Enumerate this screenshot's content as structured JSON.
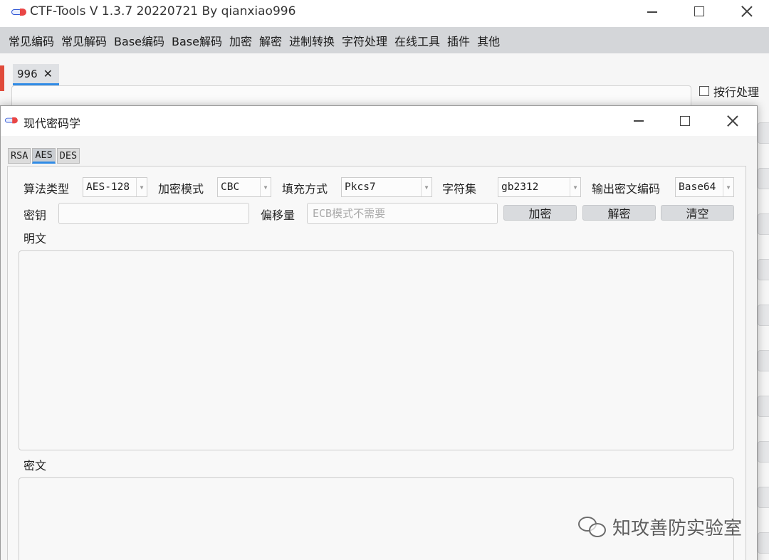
{
  "main_window": {
    "title": "CTF-Tools V 1.3.7 20220721 By qianxiao996",
    "menu": [
      "常见编码",
      "常见解码",
      "Base编码",
      "Base解码",
      "加密",
      "解密",
      "进制转换",
      "字符处理",
      "在线工具",
      "插件",
      "其他"
    ],
    "open_tab": {
      "label": "996",
      "close_glyph": "✕"
    },
    "line_by_line_label": "按行处理",
    "accent_color": "#2f8be6"
  },
  "dialog": {
    "title": "现代密码学",
    "algo_tabs": [
      "RSA",
      "AES",
      "DES"
    ],
    "active_tab": "AES",
    "form": {
      "algorithm_label": "算法类型",
      "algorithm_value": "AES-128",
      "mode_label": "加密模式",
      "mode_value": "CBC",
      "padding_label": "填充方式",
      "padding_value": "Pkcs7",
      "charset_label": "字符集",
      "charset_value": "gb2312",
      "output_label": "输出密文编码",
      "output_value": "Base64",
      "key_label": "密钥",
      "key_value": "",
      "iv_label": "偏移量",
      "iv_placeholder": "ECB模式不需要",
      "encrypt_button": "加密",
      "decrypt_button": "解密",
      "clear_button": "清空",
      "plaintext_label": "明文",
      "ciphertext_label": "密文"
    }
  },
  "watermark": {
    "text": "知攻善防实验室",
    "icon": "wechat-icon"
  }
}
